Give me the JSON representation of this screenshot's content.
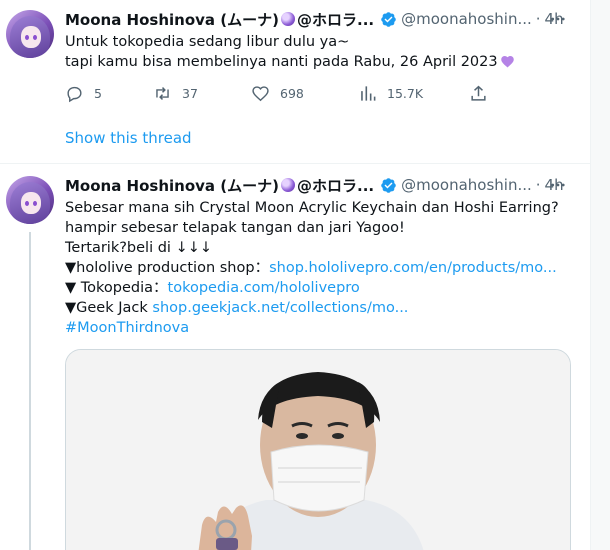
{
  "tweets": [
    {
      "author_name": "Moona Hoshinova (ムーナ)",
      "author_suffix": "@ホロラ...",
      "handle": "@moonahoshin...",
      "separator": "·",
      "time": "4h",
      "lines": [
        "Untuk tokopedia sedang libur dulu ya~",
        "tapi kamu bisa membelinya nanti pada Rabu, 26 April 2023"
      ],
      "stats": {
        "replies": "5",
        "retweets": "37",
        "likes": "698",
        "views": "15.7K"
      },
      "show_thread": "Show this thread"
    },
    {
      "author_name": "Moona Hoshinova (ムーナ)",
      "author_suffix": "@ホロラ...",
      "handle": "@moonahoshin...",
      "separator": "·",
      "time": "4h",
      "lines": [
        "Sebesar mana sih Crystal Moon Acrylic Keychain dan Hoshi Earring?",
        "hampir sebesar telapak tangan dan jari Yagoo!",
        "Tertarik?beli di ↓↓↓",
        "▼hololive production shop：",
        "▼ Tokopedia：",
        "▼Geek Jack "
      ],
      "links": {
        "hololive_shop": "shop.hololivepro.com/en/products/mo...",
        "tokopedia": "tokopedia.com/hololivepro",
        "geekjack": "shop.geekjack.net/collections/mo...",
        "hashtag": "#MoonThirdnova"
      }
    }
  ],
  "colors": {
    "link": "#1d9bf0",
    "muted": "#536471",
    "verified": "#1d9bf0",
    "heart": "#b583e6"
  }
}
